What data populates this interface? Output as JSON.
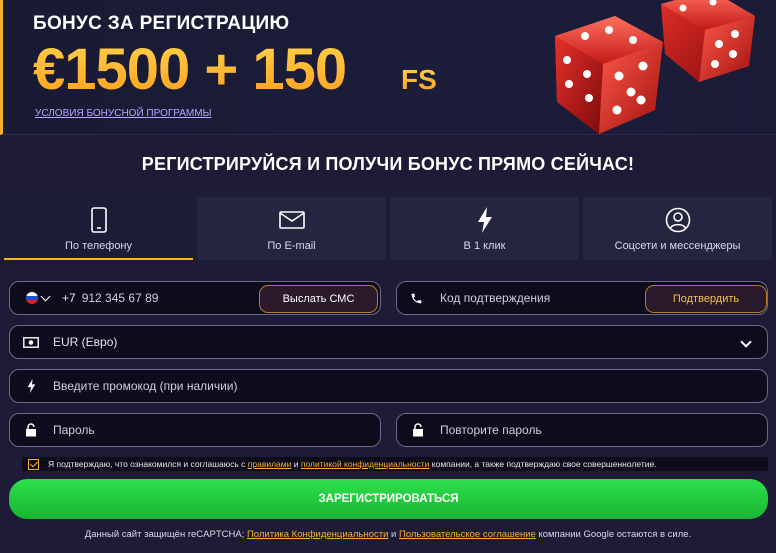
{
  "banner": {
    "title": "БОНУС ЗА РЕГИСТРАЦИЮ",
    "amount": "€1500 + 150",
    "fs": "FS",
    "terms_link": "УСЛОВИЯ БОНУСНОЙ ПРОГРАММЫ",
    "image": "red-dice"
  },
  "heading": "РЕГИСТРИРУЙСЯ И ПОЛУЧИ БОНУС ПРЯМО СЕЙЧАС!",
  "tabs": [
    {
      "label": "По телефону",
      "icon": "phone-icon",
      "active": true
    },
    {
      "label": "По E-mail",
      "icon": "envelope-icon",
      "active": false
    },
    {
      "label": "В 1 клик",
      "icon": "lightning-icon",
      "active": false
    },
    {
      "label": "Соцсети и мессенджеры",
      "icon": "user-circle-icon",
      "active": false
    }
  ],
  "form": {
    "phone": {
      "prefix": "+7",
      "placeholder": "912 345 67 89",
      "country_icon": "russia-flag-icon"
    },
    "send_sms_button": "Выслать СМС",
    "code": {
      "placeholder": "Код подтверждения",
      "icon": "phone-handset-icon"
    },
    "confirm_button": "Подтвердить",
    "currency": {
      "value": "EUR (Евро)",
      "icon": "banknote-icon"
    },
    "promo": {
      "placeholder": "Введите промокод (при наличии)",
      "icon": "lightning-icon"
    },
    "password": {
      "placeholder": "Пароль",
      "icon": "lock-icon"
    },
    "password_repeat": {
      "placeholder": "Повторите пароль",
      "icon": "lock-icon"
    }
  },
  "agreement": {
    "checked": true,
    "text_1": "Я подтверждаю, что ознакомился и соглашаюсь с ",
    "link_rules": "правилами",
    "text_2": " и ",
    "link_privacy": "политикой конфиденциальности",
    "text_3": " компании, а также подтверждаю свое совершеннолетие."
  },
  "register_button": "ЗАРЕГИСТРИРОВАТЬСЯ",
  "recaptcha": {
    "text_1": "Данный сайт защищён reCAPTCHA; ",
    "link_privacy": "Политика Конфиденциальности",
    "text_2": " и ",
    "link_terms": "Пользовательское соглашение",
    "text_3": " компании Google остаются в силе."
  },
  "colors": {
    "accent": "#f5b22a",
    "background": "#1d1b36",
    "register": "#22c93d",
    "link": "#b8a6ff"
  }
}
